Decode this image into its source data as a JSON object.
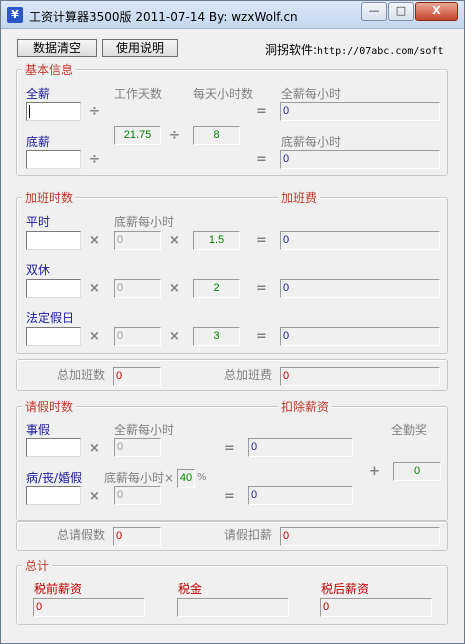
{
  "window": {
    "title": "工资计算器3500版  2011-07-14  By: wzxWolf.cn",
    "icon": "yen-icon",
    "controls": {
      "minimize": "—",
      "maximize": "□",
      "close": "X"
    }
  },
  "toolbar": {
    "clear_label": "数据清空",
    "help_label": "使用说明",
    "link_label": "洞拐软件:",
    "link_url": "http://07abc.com/soft"
  },
  "basic": {
    "group_label": "基本信息",
    "full_salary_label": "全薪",
    "full_salary_value": "",
    "base_salary_label": "底薪",
    "base_salary_value": "",
    "work_days_label": "工作天数",
    "work_days_value": "21.75",
    "hours_per_day_label": "每天小时数",
    "hours_per_day_value": "8",
    "full_hourly_label": "全薪每小时",
    "full_hourly_value": "0",
    "base_hourly_label": "底薪每小时",
    "base_hourly_value": "0",
    "div": "÷",
    "eq": "="
  },
  "overtime": {
    "group_label": "加班时数",
    "fee_label": "加班费",
    "base_hourly_label": "底薪每小时",
    "mul": "×",
    "eq": "=",
    "rows": [
      {
        "label": "平时",
        "hours": "",
        "base_hourly": "0",
        "rate": "1.5",
        "result": "0"
      },
      {
        "label": "双休",
        "hours": "",
        "base_hourly": "0",
        "rate": "2",
        "result": "0"
      },
      {
        "label": "法定假日",
        "hours": "",
        "base_hourly": "0",
        "rate": "3",
        "result": "0"
      }
    ],
    "total_hours_label": "总加班数",
    "total_hours_value": "0",
    "total_fee_label": "总加班费",
    "total_fee_value": "0"
  },
  "leave": {
    "group_label": "请假时数",
    "deduct_label": "扣除薪资",
    "full_hourly_label": "全薪每小时",
    "sick_base_label": "底薪每小时×",
    "sick_pct_value": "40",
    "pct_sign": "%",
    "bonus_label": "全勤奖",
    "bonus_value": "0",
    "mul": "×",
    "eq": "=",
    "plus": "+",
    "personal_label": "事假",
    "personal_hours": "",
    "personal_hourly": "0",
    "personal_result": "0",
    "sick_label": "病/丧/婚假",
    "sick_hours": "",
    "sick_hourly": "0",
    "sick_result": "0",
    "total_hours_label": "总请假数",
    "total_hours_value": "0",
    "total_deduct_label": "请假扣薪",
    "total_deduct_value": "0"
  },
  "summary": {
    "group_label": "总计",
    "pretax_label": "税前薪资",
    "pretax_value": "0",
    "tax_label": "税金",
    "tax_value": "",
    "aftertax_label": "税后薪资",
    "aftertax_value": "0"
  }
}
